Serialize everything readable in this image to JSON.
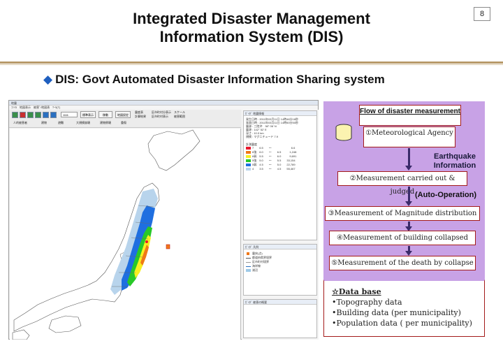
{
  "header": {
    "title_line1": "Integrated Disaster Management",
    "title_line2": "Information System (DIS)",
    "page_number": "8"
  },
  "subtitle": {
    "bullet": "◆",
    "text": "DIS: Govt Automated Disaster Information Sharing system"
  },
  "screenshot": {
    "window_title": "地震",
    "menu": "ﾌｧｲﾙ　地図表示　被害ﾞ/地図表　ﾂｰﾙ(T)",
    "toolbar": {
      "field_value": "1111",
      "btn1": "標準表示",
      "btn2": "移動",
      "btn3": "地図設定",
      "checks_row1": [
        "震度表",
        "区市町村分表示",
        "スケール"
      ],
      "checks_row2": [
        "計算結果",
        "区市町村表示",
        "被害範囲"
      ],
      "row2_items": [
        "人的被害者",
        "建物",
        "避難",
        "大規模崩壊",
        "建物倒壊",
        "重傷"
      ]
    },
    "info_panel": {
      "header": "ｶﾞｲﾀﾞ 地震情報",
      "lines": [
        "発生日時 : 2011年03月11日 14時46分18秒",
        "発表日時 : 2011年03月11日 14時50分50秒",
        "震源 : 三陸沖　38° 06'  N",
        "震源 : 142° 52'  E",
        "深さ : 10.0 km",
        "規模 : マグニチュード 7.9"
      ],
      "legend_header": "計測震度",
      "legend": [
        {
          "label": "7　　6.5　　～　　　　　　　6.6",
          "color": "#e8182c"
        },
        {
          "label": "6強　6.0　　～　　6.5　　　1,248",
          "color": "#f07818"
        },
        {
          "label": "6弱　5.5　　～　　6.0　　　9,691",
          "color": "#f8f020"
        },
        {
          "label": "5強　5.0　　～　　5.5　　33,154",
          "color": "#28c828"
        },
        {
          "label": "5弱　4.5　　～　　5.0　　22,789",
          "color": "#1f6fe0"
        },
        {
          "label": "4　　3.5　　～　　4.5　　55,467",
          "color": "#b8d4ec"
        }
      ]
    },
    "legend_panel": {
      "header": "ｶﾞｲﾀﾞ 凡例",
      "items": [
        "震央(点)",
        "都道府県界境界",
        "区市町村境界",
        "海岸線",
        "湖沼"
      ]
    },
    "detail_panel": {
      "header": "ｶﾞｲﾀﾞ 被害の概要"
    }
  },
  "flow": {
    "title": "Flow of disaster measurement",
    "step1": "①Meteorological Agency",
    "earthquake_info": "Earthquake Information",
    "step2": "②Measurement carried out & judged",
    "auto": "(Auto-Operation)",
    "step3": "③Measurement of Magnitude distribution",
    "step4": "④Measurement of building collapsed",
    "step5": "⑤Measurement of the death by collapse",
    "database": {
      "title": "☆Data base",
      "items": [
        "•Topography data",
        "•Building data (per  municipality)",
        "•Population data ( per municipality)"
      ]
    }
  },
  "colors": {
    "accent_rule": "#b89a6a",
    "flow_bg": "#c8a2e6",
    "box_border": "#a31a1a",
    "bullet": "#1f5fbf"
  }
}
